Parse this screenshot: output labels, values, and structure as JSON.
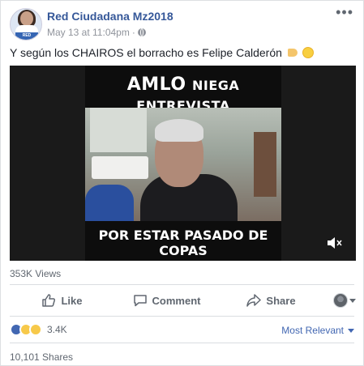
{
  "post": {
    "author": "Red Ciudadana Mz2018",
    "timestamp": "May 13 at 11:04pm",
    "separator": "·",
    "more_label": "•••",
    "text": "Y según los CHAIROS el borracho es Felipe Calderón",
    "avatar_badge": "RED CIUDADANA"
  },
  "video": {
    "title_big": "AMLO",
    "title_rest": "NIEGA ENTREVISTA",
    "caption": "POR ESTAR PASADO DE COPAS"
  },
  "stats": {
    "views": "353K Views",
    "reaction_count": "3.4K",
    "shares": "10,101 Shares",
    "sort_label": "Most Relevant"
  },
  "actions": {
    "like": "Like",
    "comment": "Comment",
    "share": "Share"
  },
  "icons": [
    "globe-icon",
    "more-icon",
    "mute-icon",
    "like-icon",
    "comment-icon",
    "share-icon",
    "chevron-down-icon"
  ],
  "colors": {
    "link": "#365899",
    "accent": "#4267b2",
    "muted": "#606770"
  }
}
